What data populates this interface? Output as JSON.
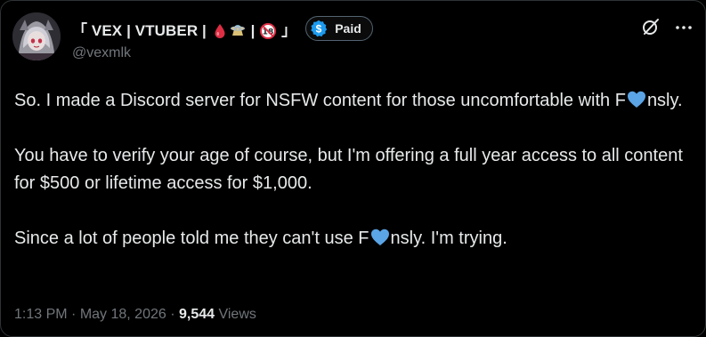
{
  "author": {
    "display_name_prefix": "「 VEX | VTUBER | ",
    "display_name_sep1": " | ",
    "display_name_suffix": " 」",
    "handle": "@vexmlk",
    "avatar_icon": "avatar-image",
    "paid_badge": {
      "label": "Paid",
      "color": "#1d9bf0"
    }
  },
  "actions": {
    "grok_icon": "grok-icon",
    "more_icon": "more-icon"
  },
  "post": {
    "p1_a": "So. I made a Discord server for NSFW content for those uncomfortable with F",
    "p1_b": "nsly.",
    "p2": "You have to verify your age of course, but I'm offering a full year access to all content for $500 or lifetime access for $1,000.",
    "p3_a": "Since a lot of people told me they can't use F",
    "p3_b": "nsly. I'm trying.",
    "heart_color": "#5ba4e6"
  },
  "meta": {
    "time": "1:13 PM",
    "date": "May 18, 2026",
    "separator": " · ",
    "views_count": "9,544",
    "views_label": " Views"
  }
}
